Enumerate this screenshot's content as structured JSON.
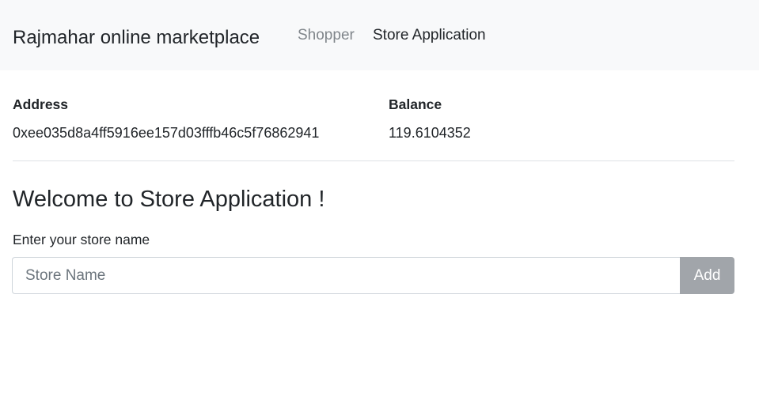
{
  "navbar": {
    "brand": "Rajmahar online marketplace",
    "links": [
      {
        "label": "Shopper"
      },
      {
        "label": "Store Application"
      }
    ]
  },
  "account": {
    "address_label": "Address",
    "address_value": "0xee035d8a4ff5916ee157d03fffb46c5f76862941",
    "balance_label": "Balance",
    "balance_value": "119.6104352"
  },
  "main": {
    "heading": "Welcome to Store Application !",
    "store_name_label": "Enter your store name",
    "store_name_placeholder": "Store Name",
    "store_name_value": "",
    "add_label": "Add"
  },
  "colors": {
    "navbar_bg": "#f8f9fa",
    "muted_link": "#80868b",
    "button_bg": "#a1a5aa",
    "text": "#212529"
  }
}
